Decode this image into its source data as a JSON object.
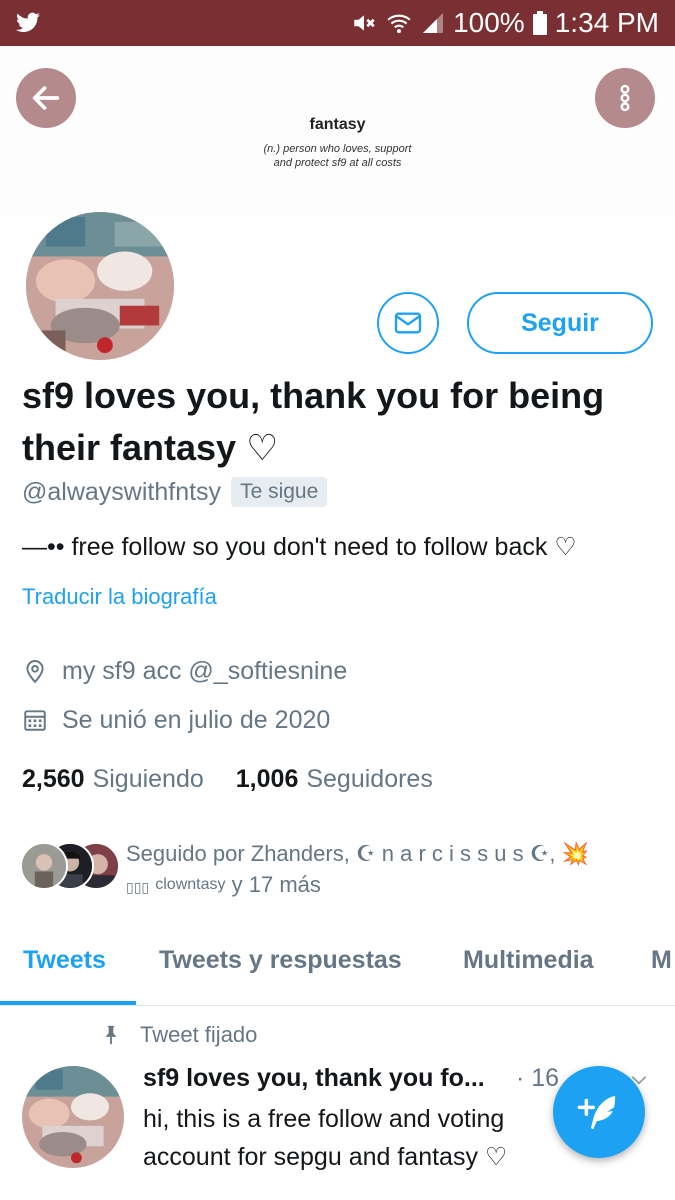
{
  "status_bar": {
    "battery": "100%",
    "time": "1:34 PM"
  },
  "banner": {
    "title": "fantasy",
    "definition_line1": "(n.) person who loves, support",
    "definition_line2": "and protect sf9 at all costs"
  },
  "actions": {
    "follow_label": "Seguir"
  },
  "profile": {
    "display_name": "sf9 loves you, thank you for being their fantasy ♡",
    "handle": "@alwayswithfntsy",
    "follows_you_badge": "Te sigue",
    "bio": "—•• free follow so you don't need to follow back ♡",
    "translate_bio": "Traducir la biografía",
    "location": "my sf9 acc @_softiesnine",
    "joined": "Se unió en julio de 2020",
    "following_count": "2,560",
    "following_label": "Siguiendo",
    "followers_count": "1,006",
    "followers_label": "Seguidores"
  },
  "followed_by": {
    "prefix": "Seguido por Zhanders, ☪︎ n a r c i s s u s ☪︎,",
    "burst": "💥",
    "boxes": "▯▯▯",
    "small_name": "clowntasy",
    "suffix": "y 17 más"
  },
  "tabs": [
    {
      "label": "Tweets"
    },
    {
      "label": "Tweets y respuestas"
    },
    {
      "label": "Multimedia"
    },
    {
      "label": "M"
    }
  ],
  "pinned_tweet": {
    "pinned_label": "Tweet fijado",
    "author_name": "sf9 loves you, thank you fo...",
    "time": "· 16",
    "text": "hi, this is a free follow and voting account for sepgu and fantasy ♡"
  },
  "colors": {
    "status_bar": "#7a2f33",
    "accent": "#1da1f2",
    "round_buttons": "#b58a8c"
  },
  "icons": {
    "status_left": "twitter-bird-icon",
    "mute": "mute-icon",
    "wifi": "wifi-icon",
    "signal": "signal-icon",
    "battery": "battery-icon",
    "back": "arrow-left-icon",
    "more": "more-vertical-icon",
    "message": "envelope-icon",
    "location": "location-pin-icon",
    "calendar": "calendar-icon",
    "pin": "pin-icon",
    "chevron": "chevron-down-icon",
    "compose": "compose-tweet-icon"
  }
}
